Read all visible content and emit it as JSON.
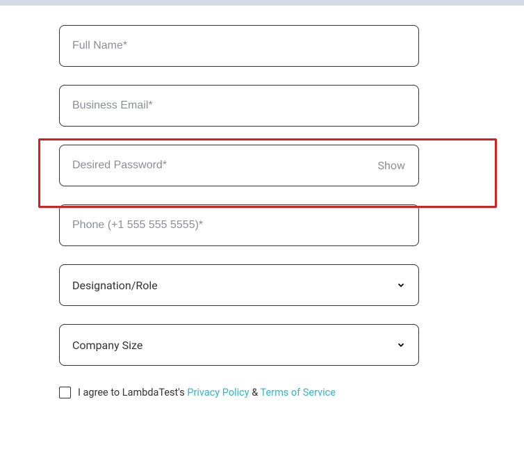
{
  "form": {
    "full_name_placeholder": "Full Name*",
    "business_email_placeholder": "Business Email*",
    "password_placeholder": "Desired Password*",
    "show_label": "Show",
    "phone_placeholder": "Phone (+1 555 555 5555)*",
    "designation_label": "Designation/Role",
    "company_size_label": "Company Size",
    "agree_prefix": "I agree to LambdaTest's ",
    "privacy_policy": "Privacy Policy",
    "ampersand": " & ",
    "terms_of_service": "Terms of Service"
  }
}
